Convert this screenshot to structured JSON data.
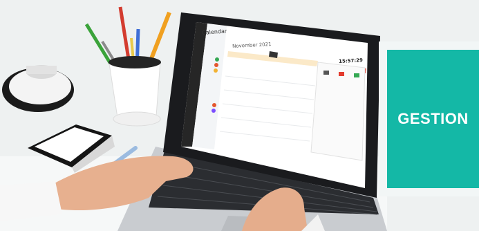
{
  "screen": {
    "app_title": "Calendar",
    "month_label": "November 2021",
    "clock": "15:57:29"
  },
  "badge": {
    "label": "GESTION"
  },
  "colors": {
    "accent": "#14b8a6",
    "background": "#eef1f1"
  }
}
